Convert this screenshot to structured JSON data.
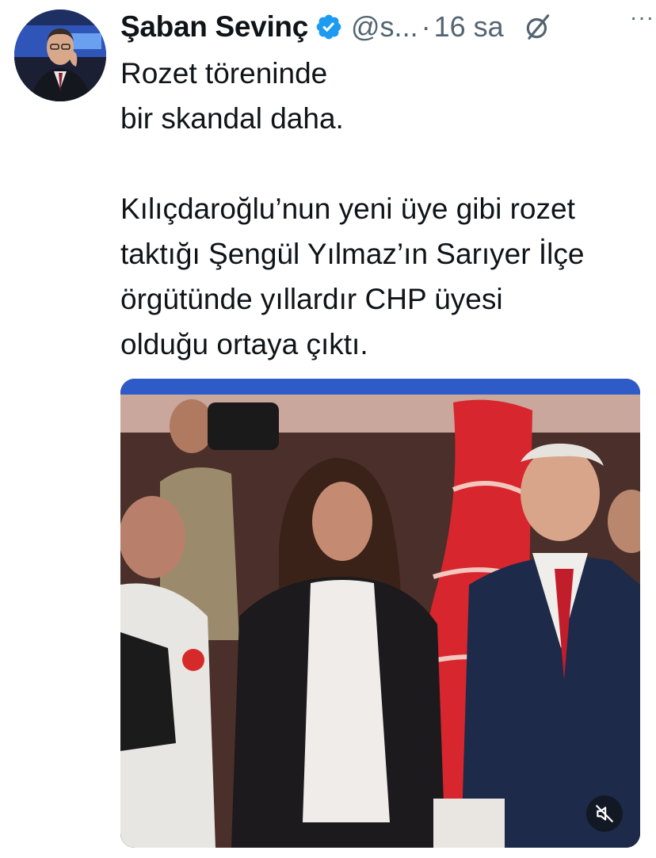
{
  "tweet": {
    "author": {
      "name": "Şaban Sevinç",
      "handle": "@s...",
      "verified": true
    },
    "separator": "·",
    "time": "16 sa",
    "more_label": "···",
    "text": {
      "line_1": "Rozet töreninde",
      "line_2": "bir skandal daha.",
      "line_3": "Kılıçdaroğlu’nun yeni üye gibi rozet",
      "line_4": "taktığı Şengül Yılmaz’ın Sarıyer İlçe",
      "line_5": "örgütünde yıllardır CHP üyesi",
      "line_6": "olduğu ortaya çıktı."
    },
    "media": {
      "type": "video",
      "muted": true
    }
  },
  "icons": {
    "verified": "verified-badge-icon",
    "grok": "grok-icon",
    "more": "more-icon",
    "mute": "volume-muted-icon"
  },
  "colors": {
    "verified_blue": "#1d9bf0",
    "secondary_text": "#536471",
    "primary_text": "#0f1419"
  }
}
